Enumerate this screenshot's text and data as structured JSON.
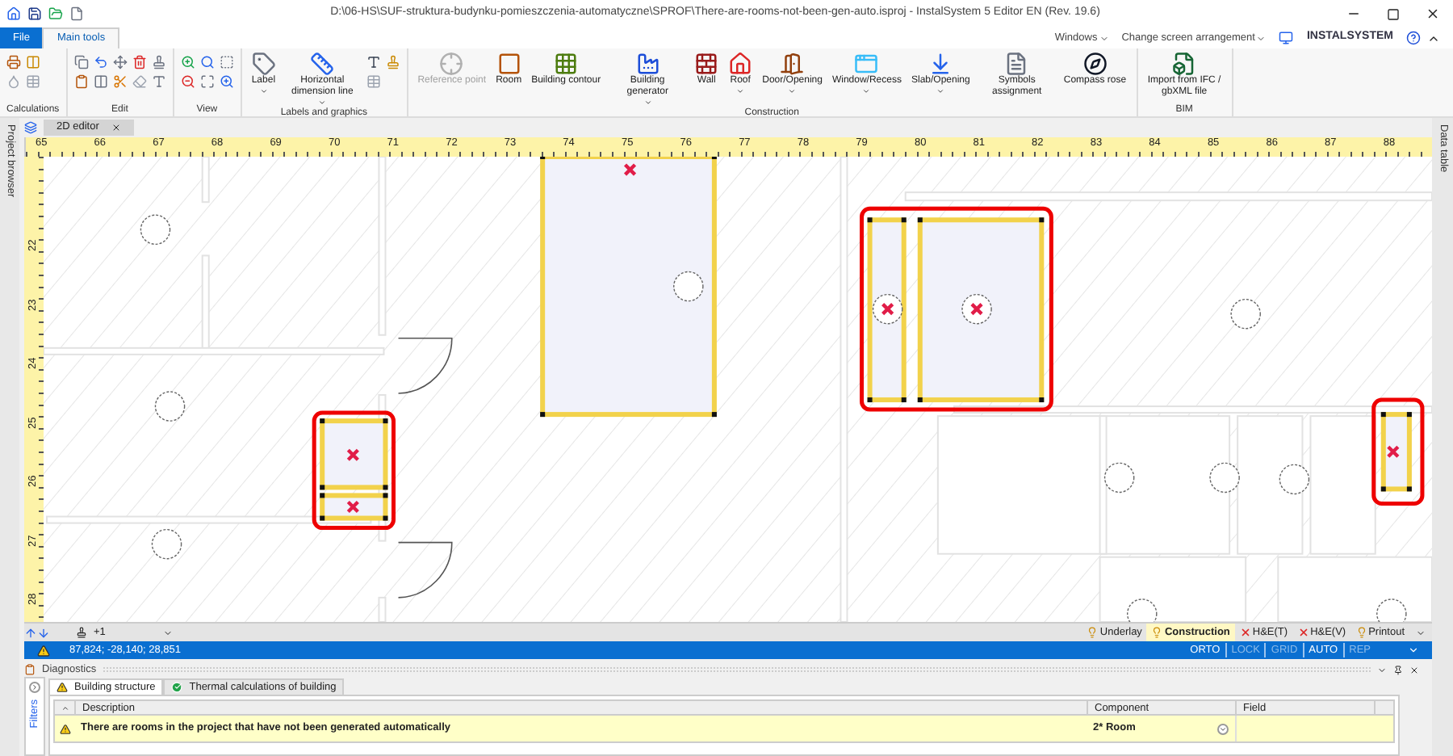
{
  "title_bar": {
    "title": "D:\\06-HS\\SUF-struktura-budynku-pomieszczenia-automatyczne\\SPROF\\There-are-rooms-not-been-gen-auto.isproj - InstalSystem 5 Editor EN (Rev. 19.6)"
  },
  "ribbon_tabs": [
    {
      "label": "File",
      "kind": "file",
      "selected": false
    },
    {
      "label": "Main tools",
      "kind": "tab",
      "selected": true
    }
  ],
  "top_menu": [
    {
      "label": "Windows"
    },
    {
      "label": "Change screen arrangement"
    }
  ],
  "logo": "INSTALSYSTEM",
  "ribbon_groups": [
    {
      "label": "Calculations"
    },
    {
      "label": "Edit"
    },
    {
      "label": "View"
    },
    {
      "label": "Labels and graphics",
      "buttons": [
        {
          "label": "Label",
          "dropdown": true,
          "disabled": false
        },
        {
          "label": "Horizontal dimension line",
          "dropdown": true,
          "disabled": false
        }
      ]
    },
    {
      "label": "Construction",
      "buttons": [
        {
          "label": "Reference point",
          "dropdown": false,
          "disabled": true
        },
        {
          "label": "Room",
          "dropdown": false,
          "disabled": false
        },
        {
          "label": "Building contour",
          "dropdown": false,
          "disabled": false
        },
        {
          "label": "Building generator",
          "dropdown": true,
          "disabled": false
        },
        {
          "label": "Wall",
          "dropdown": false,
          "disabled": false
        },
        {
          "label": "Roof",
          "dropdown": true,
          "disabled": false
        },
        {
          "label": "Door/Opening",
          "dropdown": true,
          "disabled": false
        },
        {
          "label": "Window/Recess",
          "dropdown": true,
          "disabled": false
        },
        {
          "label": "Slab/Opening",
          "dropdown": true,
          "disabled": false
        },
        {
          "label": "Symbols assignment",
          "dropdown": false,
          "disabled": false
        },
        {
          "label": "Compass rose",
          "dropdown": false,
          "disabled": false
        }
      ]
    },
    {
      "label": "BIM",
      "buttons": [
        {
          "label": "Import from IFC / gbXML file",
          "dropdown": false,
          "disabled": false
        }
      ]
    }
  ],
  "document_tabs": [
    {
      "label": "2D editor",
      "selected": true
    }
  ],
  "side_panels": {
    "left": "Project browser",
    "right": "Data table"
  },
  "ruler": {
    "x_labels": [
      "65",
      "66",
      "67",
      "68",
      "69",
      "70",
      "71",
      "72",
      "73",
      "74",
      "75",
      "76",
      "77",
      "78",
      "79",
      "80",
      "81",
      "82",
      "83",
      "84",
      "85",
      "86",
      "87",
      "88"
    ],
    "y_labels": [
      "22",
      "23",
      "24",
      "25",
      "26",
      "27",
      "28"
    ]
  },
  "layer_bar": {
    "level": "+1",
    "layers": [
      {
        "label": "Underlay",
        "visible": true,
        "selected": false
      },
      {
        "label": "Construction",
        "visible": true,
        "selected": true
      },
      {
        "label": "H&E(T)",
        "visible": false,
        "selected": false
      },
      {
        "label": "H&E(V)",
        "visible": false,
        "selected": false
      },
      {
        "label": "Printout",
        "visible": true,
        "selected": false
      }
    ]
  },
  "status_bar": {
    "coordinates": "87,824; -28,140; 28,851",
    "modes": [
      {
        "label": "ORTO",
        "on": true
      },
      {
        "label": "LOCK",
        "on": false
      },
      {
        "label": "GRID",
        "on": false
      },
      {
        "label": "AUTO",
        "on": true
      },
      {
        "label": "REP",
        "on": false
      }
    ]
  },
  "diagnostics": {
    "title": "Diagnostics",
    "filters": "Filters",
    "tabs": [
      {
        "label": "Building structure",
        "kind": "warning",
        "selected": true
      },
      {
        "label": "Thermal calculations of building",
        "kind": "ok",
        "selected": false
      }
    ],
    "columns": [
      "Description",
      "Component",
      "Field"
    ],
    "rows": [
      {
        "kind": "warning",
        "description": "There are rooms in the project that have not been generated automatically",
        "component": "2* Room"
      }
    ]
  }
}
